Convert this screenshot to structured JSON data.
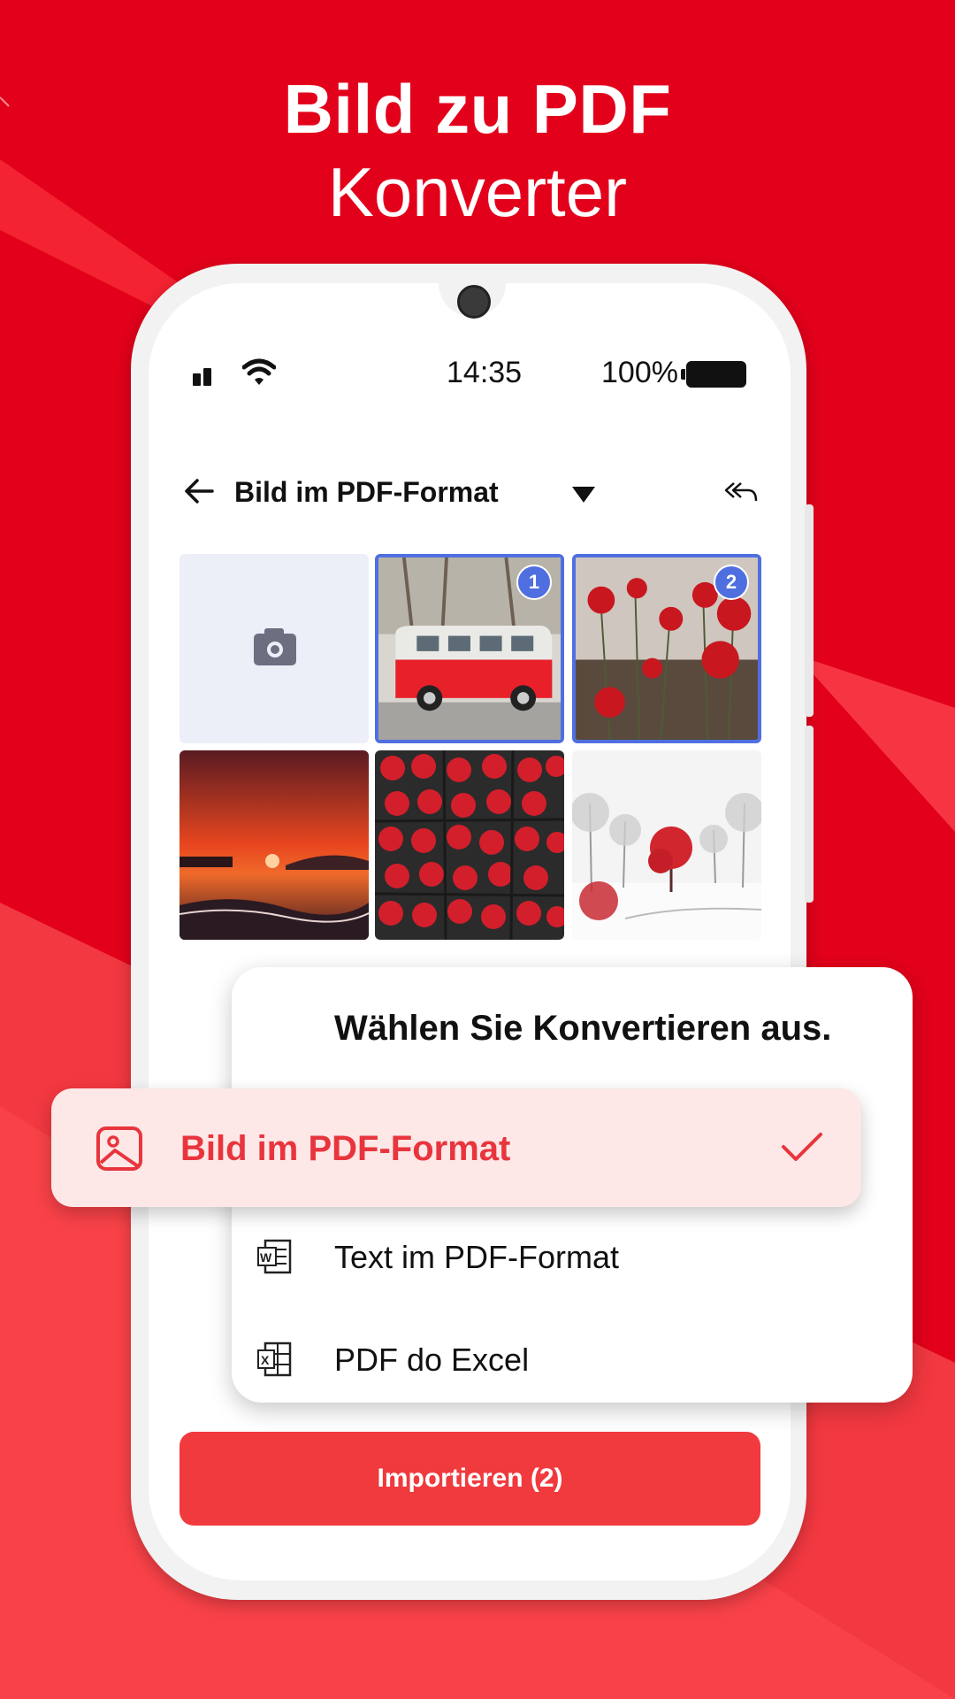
{
  "headline": {
    "line1": "Bild zu PDF",
    "line2": "Konverter"
  },
  "status_bar": {
    "time": "14:35",
    "battery": "100%"
  },
  "toolbar": {
    "title": "Bild im PDF-Format",
    "icons": [
      "arrow-left-icon",
      "dropdown-triangle-icon",
      "undo-icon"
    ]
  },
  "gallery": {
    "tiles": [
      {
        "type": "camera",
        "icon": "camera-icon"
      },
      {
        "type": "photo",
        "subject": "red van",
        "selected_index": "1"
      },
      {
        "type": "photo",
        "subject": "red poppies",
        "selected_index": "2"
      },
      {
        "type": "photo",
        "subject": "sunset over sea"
      },
      {
        "type": "photo",
        "subject": "raspberries"
      },
      {
        "type": "photo",
        "subject": "snowy park with red tree"
      }
    ]
  },
  "converter_popup": {
    "title": "Wählen Sie Konvertieren aus.",
    "options": [
      {
        "label": "Bild im PDF-Format",
        "icon": "image-icon",
        "selected": true
      },
      {
        "label": "Text im PDF-Format",
        "icon": "word-doc-icon",
        "selected": false
      },
      {
        "label": "PDF do Excel",
        "icon": "excel-doc-icon",
        "selected": false
      }
    ]
  },
  "import_button": {
    "label": "Importieren (2)"
  },
  "colors": {
    "background": "#e3001b",
    "accent": "#f03a3e",
    "selection": "#4f6fe0",
    "selected_option_bg": "#fde7e7"
  }
}
